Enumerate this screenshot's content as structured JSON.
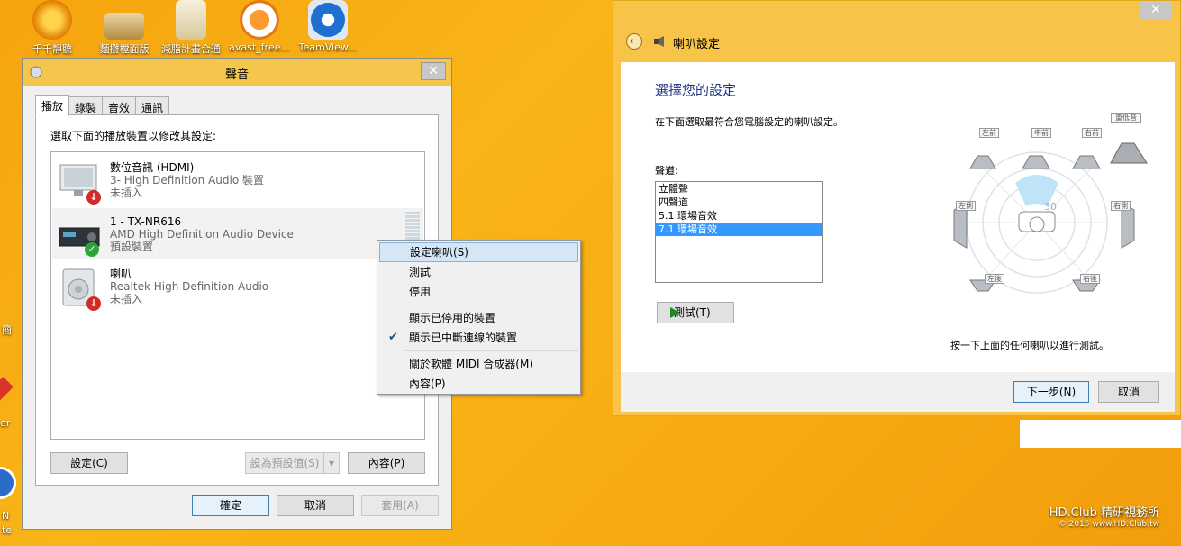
{
  "desktop": {
    "icons": [
      {
        "label": "千千靜聽"
      },
      {
        "label": "麵攤樘面版"
      },
      {
        "label": "減脂計畫合通"
      },
      {
        "label": "avast_free..."
      },
      {
        "label": "TeamView..."
      }
    ],
    "edge_labels": [
      "簡",
      "er",
      "N",
      "te"
    ],
    "watermark_line1": "HD.Club 精研視務所",
    "watermark_line2": "© 2015  www.HD.Club.tw"
  },
  "sound_dialog": {
    "title": "聲音",
    "close_glyph": "✕",
    "tabs": [
      "播放",
      "錄製",
      "音效",
      "通訊"
    ],
    "instruction": "選取下面的播放裝置以修改其設定:",
    "devices": [
      {
        "name": "數位音訊 (HDMI)",
        "driver": "3- High Definition Audio 裝置",
        "status": "未插入"
      },
      {
        "name": "1 - TX-NR616",
        "driver": "AMD High Definition Audio Device",
        "status": "預設裝置"
      },
      {
        "name": "喇叭",
        "driver": "Realtek High Definition Audio",
        "status": "未插入"
      }
    ],
    "buttons": {
      "configure": "設定(C)",
      "set_default": "設為預設值(S)",
      "properties": "內容(P)",
      "ok": "確定",
      "cancel": "取消",
      "apply": "套用(A)"
    }
  },
  "context_menu": {
    "items": [
      {
        "label": "設定喇叭(S)"
      },
      {
        "label": "測試"
      },
      {
        "label": "停用"
      },
      {
        "label": "顯示已停用的裝置"
      },
      {
        "label": "顯示已中斷連線的裝置"
      },
      {
        "label": "關於軟體 MIDI 合成器(M)"
      },
      {
        "label": "內容(P)"
      }
    ]
  },
  "speaker_setup": {
    "window_title": "喇叭設定",
    "close_glyph": "✕",
    "back_glyph": "←",
    "heading": "選擇您的設定",
    "description": "在下面選取最符合您電腦設定的喇叭設定。",
    "channels_label": "聲道:",
    "channels": [
      "立體聲",
      "四聲道",
      "5.1 環場音效",
      "7.1 環場音效"
    ],
    "selected_channel": "7.1 環場音效",
    "test_button": "測試(T)",
    "hint": "按一下上面的任何喇叭以進行測試。",
    "speakers": {
      "front_left": "左前",
      "center": "中前",
      "front_right": "右前",
      "subwoofer": "重低音",
      "side_left": "左側",
      "side_right": "右側",
      "rear_left": "左後",
      "rear_right": "右後"
    },
    "next_button": "下一步(N)",
    "cancel_button": "取消"
  },
  "colors": {
    "accent_selection": "#3399ff",
    "default_badge": "#2aa53b",
    "unplugged_badge": "#d12a2a",
    "heading_blue": "#1e3287"
  }
}
